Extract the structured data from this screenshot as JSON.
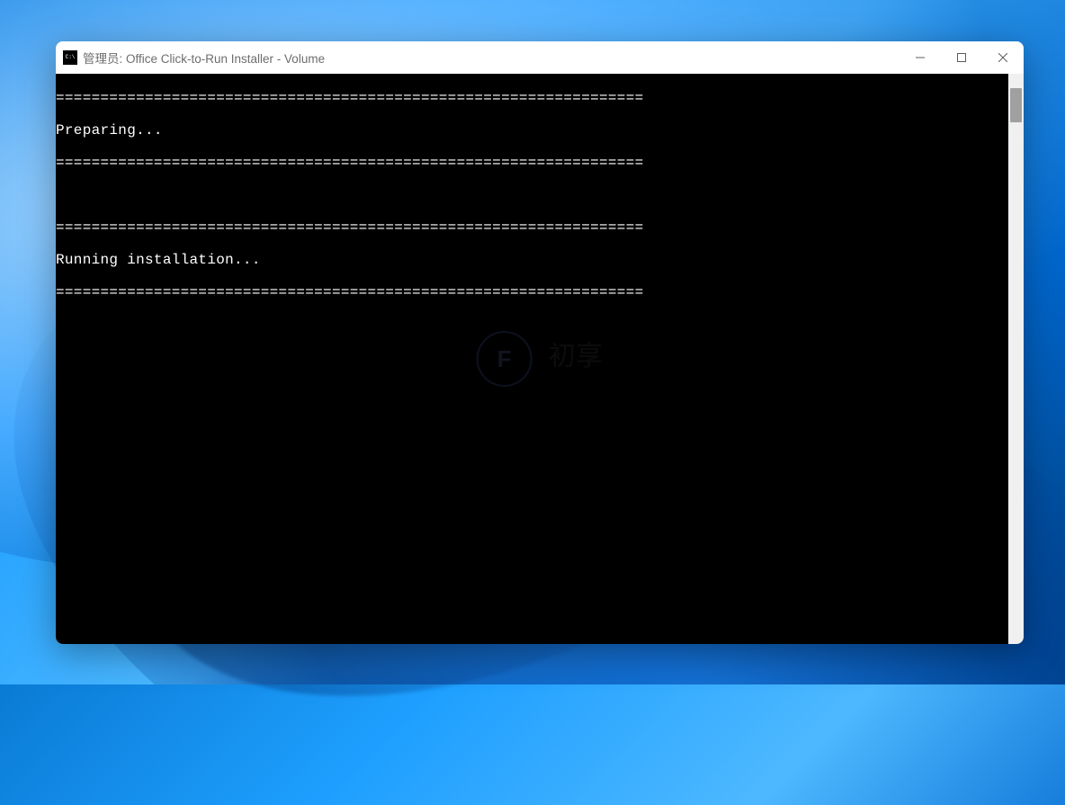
{
  "window": {
    "title": "管理员:  Office Click-to-Run Installer - Volume"
  },
  "console": {
    "lines": [
      "==================================================================",
      "Preparing...",
      "==================================================================",
      "",
      "",
      "==================================================================",
      "Running installation...",
      "=================================================================="
    ]
  },
  "watermark": {
    "letter": "F",
    "text": "初享"
  }
}
